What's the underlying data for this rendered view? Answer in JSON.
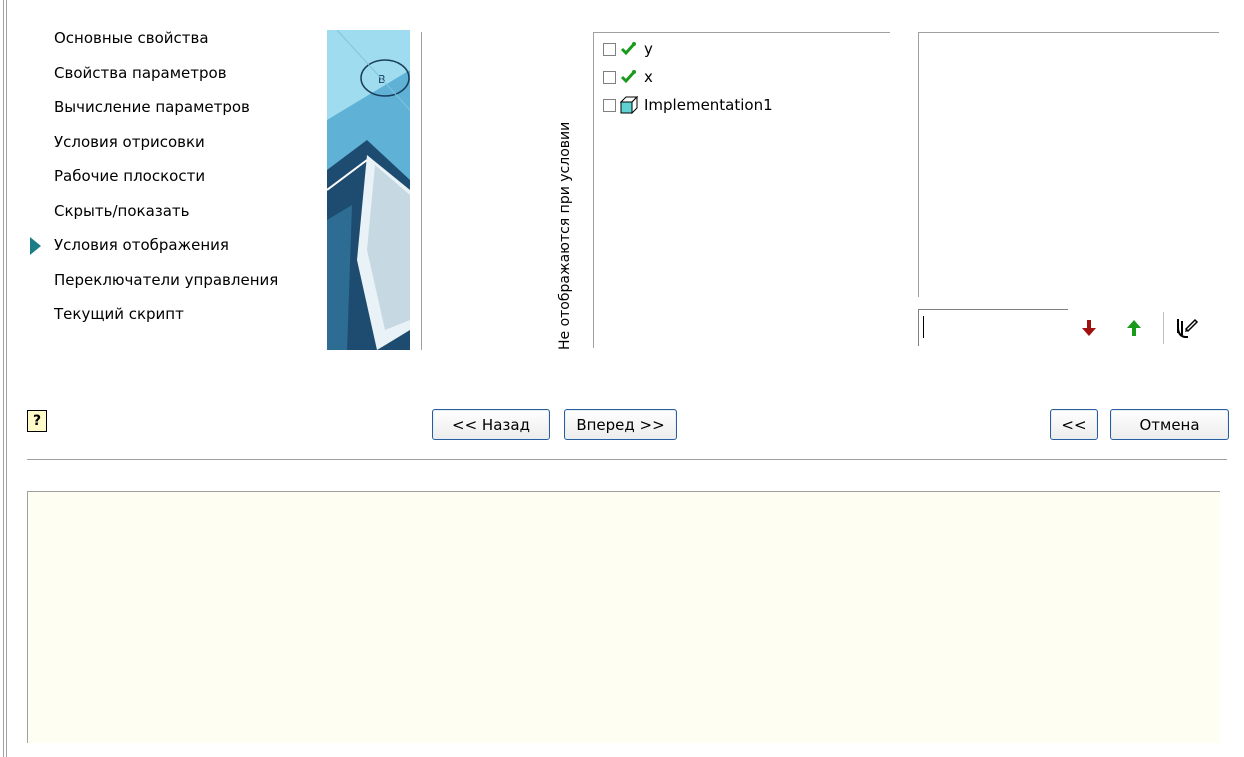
{
  "steps": [
    {
      "label": "Основные свойства"
    },
    {
      "label": "Свойства параметров"
    },
    {
      "label": "Вычисление параметров"
    },
    {
      "label": "Условия отрисовки"
    },
    {
      "label": "Рабочие плоскости"
    },
    {
      "label": "Скрыть/показать"
    },
    {
      "label": "Условия отображения",
      "current": true
    },
    {
      "label": "Переключатели управления"
    },
    {
      "label": "Текущий скрипт"
    }
  ],
  "hidden_panel": {
    "vertical_label": "Не отображаются при условии",
    "items": [
      {
        "label": "y",
        "icon": "green-check-icon",
        "checked": false
      },
      {
        "label": "x",
        "icon": "green-check-icon",
        "checked": false
      },
      {
        "label": "Implementation1",
        "icon": "cube-icon",
        "checked": false
      }
    ]
  },
  "condition_input": {
    "value": ""
  },
  "toolbar": {
    "down_icon": "red-arrow-down-icon",
    "up_icon": "green-arrow-up-icon",
    "edit_icon": "hand-edit-icon"
  },
  "nav": {
    "back_label": "<< Назад",
    "next_label": "Вперед >>",
    "collapse_label": "<<",
    "cancel_label": "Отмена",
    "help_label": "?"
  },
  "colors": {
    "current_marker": "#1d7d86",
    "button_border": "#2a5d9b",
    "info_bg": "#fffef2"
  }
}
